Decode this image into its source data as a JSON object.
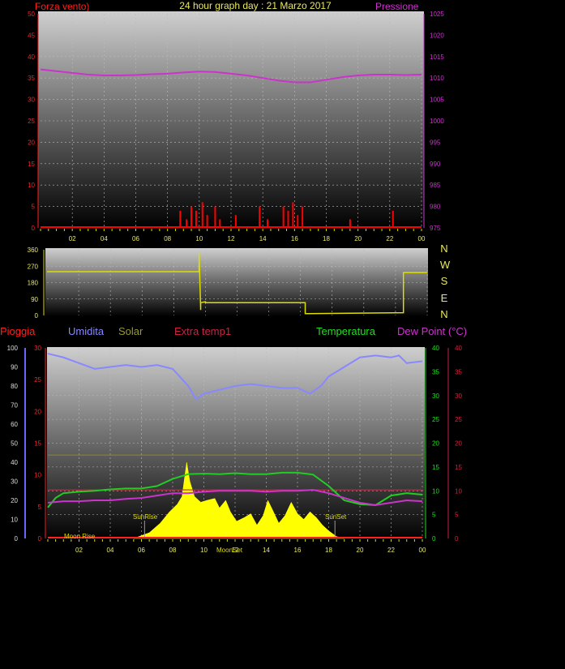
{
  "header": {
    "title": "24 hour graph day : 21 Marzo 2017",
    "left_label": "Forza vento)",
    "right_label": "Pressione"
  },
  "legend3": {
    "rain": "Pioggia",
    "humidity": "Umidita",
    "solar": "Solar",
    "extra_temp": "Extra temp1",
    "temperature": "Temperatura",
    "dew_point": "Dew Point (°C)"
  },
  "compass": [
    "N",
    "W",
    "S",
    "E",
    "N"
  ],
  "annotations": {
    "moon_rise": "Moon Rise",
    "sunrise": "SunRise",
    "moon_set": "MoonSet",
    "sunset": "SunSet"
  },
  "colors": {
    "wind": "#ff0000",
    "pressure": "#cc33cc",
    "direction": "#dddd00",
    "humidity": "#8888ff",
    "solar": "#ffff00",
    "solar_label": "#999900",
    "extra_temp": "#cc2244",
    "temperature": "#22cc22",
    "dew_point": "#cc33cc",
    "rain_axis": "#6666ff"
  },
  "chart_data": [
    {
      "type": "line",
      "title": "24 hour graph day : 21 Marzo 2017",
      "x_ticks": [
        "02",
        "04",
        "06",
        "08",
        "10",
        "12",
        "14",
        "16",
        "18",
        "20",
        "22",
        "00"
      ],
      "y_left_ticks": [
        0,
        5,
        10,
        15,
        20,
        25,
        30,
        35,
        40,
        45,
        50
      ],
      "y_left_range": [
        0,
        50
      ],
      "y_right_ticks": [
        975,
        980,
        985,
        990,
        995,
        1000,
        1005,
        1010,
        1015,
        1020,
        1025
      ],
      "y_right_range": [
        975,
        1025
      ],
      "series": [
        {
          "name": "Pressione",
          "x": [
            0,
            1,
            2,
            3,
            4,
            5,
            6,
            7,
            8,
            9,
            10,
            11,
            12,
            13,
            14,
            15,
            16,
            17,
            18,
            19,
            20,
            21,
            22,
            23,
            24
          ],
          "values": [
            1012,
            1011.6,
            1011.2,
            1010.8,
            1010.6,
            1010.6,
            1010.7,
            1010.9,
            1011,
            1011.3,
            1011.5,
            1011.4,
            1011,
            1010.6,
            1010,
            1009.4,
            1009,
            1009,
            1009.6,
            1010.2,
            1010.6,
            1010.8,
            1010.8,
            1010.7,
            1010.8
          ]
        },
        {
          "name": "Forza vento)",
          "x": [
            8.8,
            9.2,
            9.5,
            9.8,
            10.2,
            10.5,
            11,
            11.3,
            12.3,
            13.8,
            14.3,
            15.3,
            15.6,
            15.9,
            16.2,
            16.5,
            19.5,
            22.2
          ],
          "values": [
            4,
            2,
            5,
            4,
            6,
            3,
            5,
            2,
            3,
            5,
            2,
            5,
            4,
            6,
            3,
            5,
            2,
            4
          ]
        }
      ]
    },
    {
      "type": "line",
      "x_ticks": [],
      "y_ticks": [
        0,
        90,
        180,
        270,
        360
      ],
      "y_range": [
        0,
        360
      ],
      "series": [
        {
          "name": "direction",
          "x": [
            0,
            9.6,
            9.6,
            9.7,
            9.7,
            10,
            10,
            16.3,
            16.3,
            22.5,
            22.5,
            24
          ],
          "values": [
            240,
            240,
            345,
            30,
            70,
            75,
            70,
            70,
            10,
            15,
            235,
            235
          ]
        }
      ]
    },
    {
      "type": "line",
      "x_ticks": [
        "02",
        "04",
        "06",
        "08",
        "10",
        "12",
        "14",
        "16",
        "18",
        "20",
        "22",
        "00"
      ],
      "y_rain_ticks": [
        0,
        10,
        20,
        30,
        40,
        50,
        60,
        70,
        80,
        90,
        100
      ],
      "y_mid_ticks": [
        0,
        5,
        10,
        15,
        20,
        25,
        30
      ],
      "y_right_ticks": [
        0,
        5,
        10,
        15,
        20,
        25,
        30,
        35,
        40
      ],
      "y_right_range": [
        0,
        40
      ],
      "series": [
        {
          "name": "Umidita",
          "x": [
            0,
            1,
            2,
            3,
            4,
            5,
            6,
            7,
            8,
            9,
            9.5,
            10,
            11,
            12,
            13,
            14,
            15,
            16,
            16.8,
            17.5,
            18,
            19,
            20,
            21,
            22,
            22.5,
            23,
            24
          ],
          "values": [
            97,
            95,
            92,
            89,
            90,
            91,
            90,
            91,
            89,
            80,
            73,
            76,
            78,
            80,
            81,
            80,
            79,
            79,
            76,
            80,
            85,
            90,
            95,
            96,
            95,
            96,
            92,
            93
          ]
        },
        {
          "name": "Solar",
          "x": [
            0,
            24
          ],
          "values": [
            17.5,
            17.5
          ]
        },
        {
          "name": "Extra temp1",
          "x": [
            0,
            24
          ],
          "values": [
            10.2,
            10.2
          ]
        },
        {
          "name": "Temperatura",
          "x": [
            0,
            0.5,
            1,
            2,
            3,
            4,
            5,
            6,
            7,
            8,
            9,
            10,
            11,
            12,
            13,
            14,
            15,
            16,
            17,
            18,
            19,
            20,
            21,
            22,
            23,
            24
          ],
          "values": [
            6.5,
            8.5,
            9.5,
            9.8,
            10,
            10.3,
            10.5,
            10.5,
            11,
            12.5,
            13.5,
            13.6,
            13.5,
            13.7,
            13.5,
            13.5,
            13.8,
            13.8,
            13.4,
            11,
            8,
            7.2,
            7,
            9,
            9.5,
            9.2
          ]
        },
        {
          "name": "Dew Point (°C)",
          "x": [
            0,
            1,
            2,
            3,
            4,
            5,
            6,
            7,
            8,
            9,
            10,
            11,
            12,
            13,
            14,
            15,
            16,
            17,
            18,
            19,
            20,
            21,
            22,
            23,
            24
          ],
          "values": [
            7.5,
            7.8,
            7.8,
            8,
            8,
            8.3,
            8.5,
            9,
            9.5,
            9.5,
            9.8,
            10,
            10,
            10,
            9.8,
            10,
            10,
            10.2,
            9.5,
            8.5,
            7.5,
            7,
            7.5,
            8,
            7.8
          ]
        }
      ]
    }
  ]
}
